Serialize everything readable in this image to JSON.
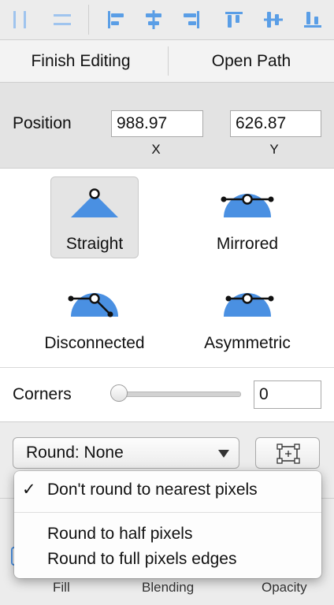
{
  "edit_row": {
    "finish_label": "Finish Editing",
    "open_path_label": "Open Path"
  },
  "position": {
    "label": "Position",
    "x_value": "988.97",
    "y_value": "626.87",
    "x_axis": "X",
    "y_axis": "Y"
  },
  "point_types": [
    {
      "label": "Straight",
      "selected": true
    },
    {
      "label": "Mirrored",
      "selected": false
    },
    {
      "label": "Disconnected",
      "selected": false
    },
    {
      "label": "Asymmetric",
      "selected": false
    }
  ],
  "corners": {
    "label": "Corners",
    "value": "0"
  },
  "round_popup": {
    "selected": "Round: None"
  },
  "menu": {
    "items": [
      {
        "label": "Don't round to nearest pixels",
        "checked": true
      },
      {
        "label": "Round to half pixels",
        "checked": false
      },
      {
        "label": "Round to full pixels edges",
        "checked": false
      }
    ],
    "check_glyph": "✓"
  },
  "bottom_labels": {
    "fill": "Fill",
    "blending": "Blending",
    "opacity": "Opacity"
  },
  "colors": {
    "accent": "#4a90e2",
    "icon_blue": "#5a9ee6"
  }
}
